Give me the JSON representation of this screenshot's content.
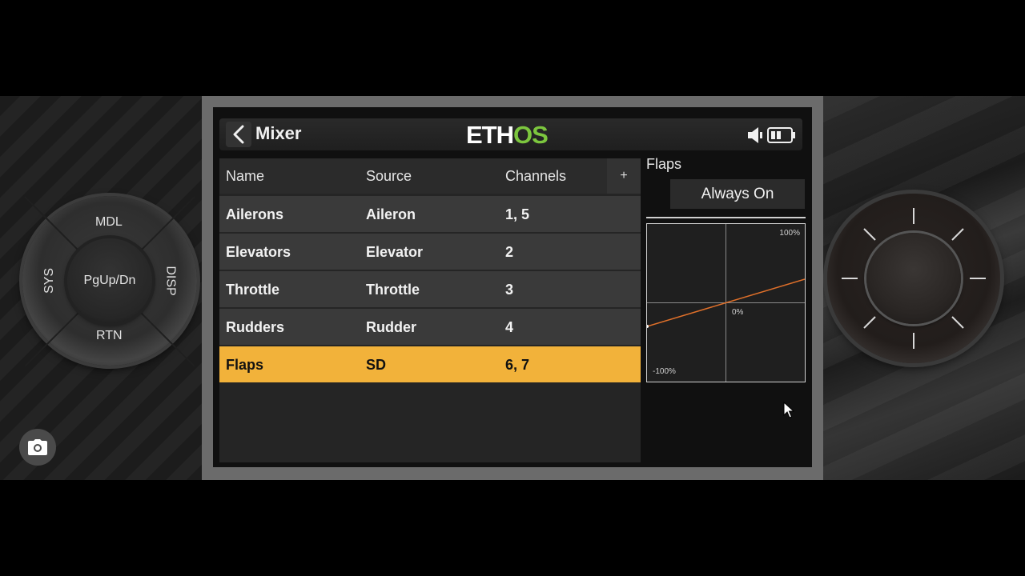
{
  "nav_dial": {
    "top": "MDL",
    "left": "SYS",
    "right": "DISP",
    "bottom": "RTN",
    "center": "PgUp/Dn"
  },
  "header": {
    "title": "Mixer",
    "logo_left": "ETH",
    "logo_right": "OS",
    "icons": [
      "back-icon",
      "speaker-icon",
      "battery-icon"
    ]
  },
  "table": {
    "columns": [
      "Name",
      "Source",
      "Channels"
    ],
    "add_label": "+",
    "rows": [
      {
        "name": "Ailerons",
        "source": "Aileron",
        "channels": "1, 5"
      },
      {
        "name": "Elevators",
        "source": "Elevator",
        "channels": "2"
      },
      {
        "name": "Throttle",
        "source": "Throttle",
        "channels": "3"
      },
      {
        "name": "Rudders",
        "source": "Rudder",
        "channels": "4"
      },
      {
        "name": "Flaps",
        "source": "SD",
        "channels": "6, 7"
      }
    ],
    "selected_index": 4
  },
  "side_panel": {
    "title": "Flaps",
    "active_condition": "Always On",
    "curve": {
      "max_label": "100%",
      "mid_label": "0%",
      "min_label": "-100%",
      "line_color": "#e0702a"
    }
  },
  "colors": {
    "selected_row": "#f2b23a",
    "logo_accent": "#7cc63e"
  }
}
